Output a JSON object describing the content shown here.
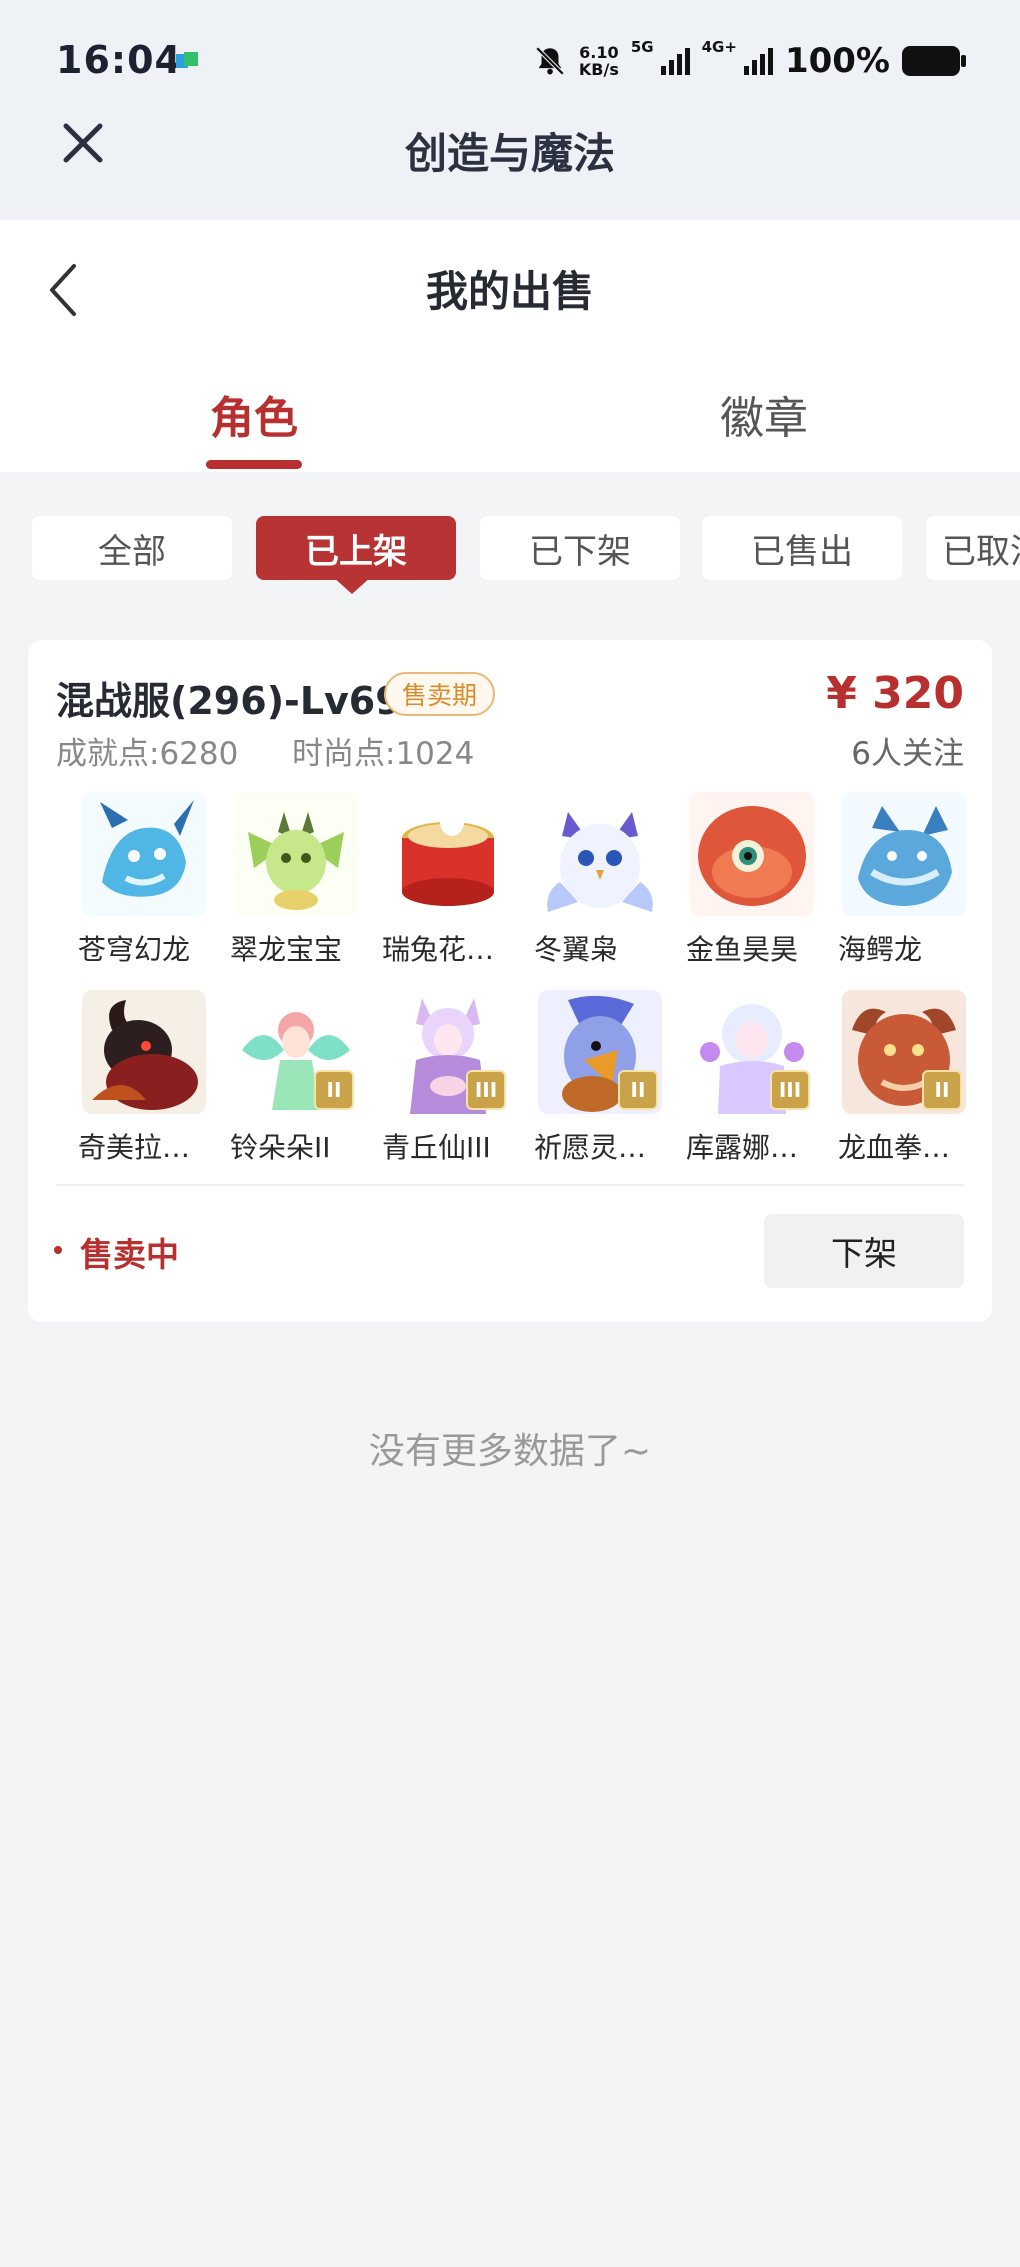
{
  "status_bar": {
    "time": "16:04",
    "speed_value": "6.10",
    "speed_unit": "KB/s",
    "net1": "5G",
    "net2": "4G+",
    "battery": "100%"
  },
  "app_bar": {
    "title": "创造与魔法",
    "close_icon": "close-icon"
  },
  "header": {
    "title": "我的出售",
    "back_icon": "back-chevron-icon"
  },
  "tabs": [
    {
      "label": "角色",
      "active": true
    },
    {
      "label": "徽章",
      "active": false
    }
  ],
  "filters": [
    {
      "label": "全部"
    },
    {
      "label": "已上架",
      "active": true
    },
    {
      "label": "已下架"
    },
    {
      "label": "已售出"
    },
    {
      "label": "已取消"
    }
  ],
  "listing": {
    "server": "混战服(296)-Lv69",
    "tag": "售卖期",
    "price": "¥ 320",
    "watchers": "6人关注",
    "achievement": "成就点:6280",
    "fashion": "时尚点:1024",
    "pets": [
      {
        "name": "苍穹幻龙"
      },
      {
        "name": "翠龙宝宝"
      },
      {
        "name": "瑞兔花…"
      },
      {
        "name": "冬翼枭"
      },
      {
        "name": "金鱼昊昊"
      },
      {
        "name": "海鳄龙"
      },
      {
        "name": "奇美拉…"
      },
      {
        "name": "铃朵朵II",
        "tier": "II"
      },
      {
        "name": "青丘仙III",
        "tier": "III"
      },
      {
        "name": "祈愿灵…",
        "tier": "II"
      },
      {
        "name": "库露娜…",
        "tier": "III"
      },
      {
        "name": "龙血拳…",
        "tier": "II"
      }
    ],
    "status": "售卖中",
    "action": "下架"
  },
  "footer_text": "没有更多数据了~",
  "colors": {
    "accent": "#b72f2f",
    "tag": "#d98c2b"
  }
}
